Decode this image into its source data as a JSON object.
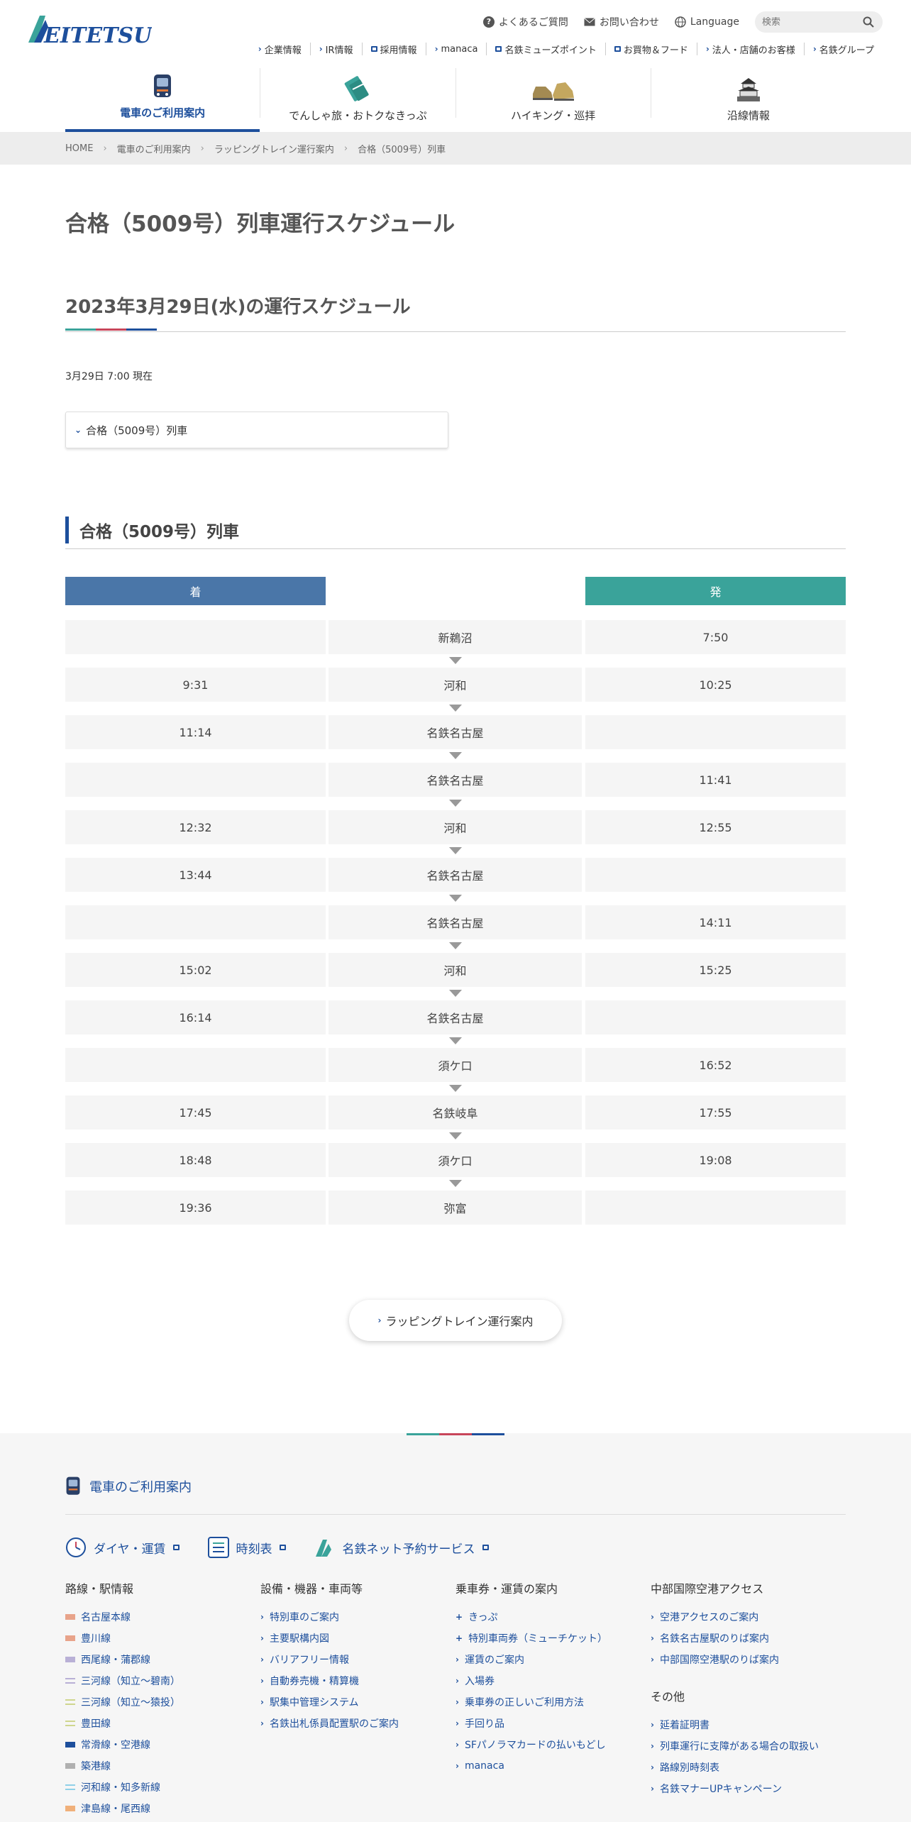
{
  "header": {
    "logo": "MEITETSU",
    "util": {
      "faq": "よくあるご質問",
      "contact": "お問い合わせ",
      "language": "Language",
      "search_placeholder": "検索"
    },
    "subnav": [
      "企業情報",
      "IR情報",
      "採用情報",
      "manaca",
      "名鉄ミューズポイント",
      "お買物＆フード",
      "法人・店舗のお客様",
      "名鉄グループ"
    ],
    "gnav": [
      "電車のご利用案内",
      "でんしゃ旅・おトクなきっぷ",
      "ハイキング・巡拝",
      "沿線情報"
    ]
  },
  "breadcrumb": [
    "HOME",
    "電車のご利用案内",
    "ラッピングトレイン運行案内",
    "合格（5009号）列車"
  ],
  "page": {
    "title": "合格（5009号）列車運行スケジュール",
    "date_heading": "2023年3月29日(水)の運行スケジュール",
    "as_of": "3月29日 7:00 現在",
    "toc_item": "合格（5009号）列車",
    "section_heading": "合格（5009号）列車",
    "col_arrive": "着",
    "col_depart": "発",
    "back_button": "ラッピングトレイン運行案内"
  },
  "schedule": [
    {
      "arr": "",
      "station": "新鵜沼",
      "dep": "7:50"
    },
    {
      "arr": "9:31",
      "station": "河和",
      "dep": "10:25"
    },
    {
      "arr": "11:14",
      "station": "名鉄名古屋",
      "dep": ""
    },
    {
      "arr": "",
      "station": "名鉄名古屋",
      "dep": "11:41"
    },
    {
      "arr": "12:32",
      "station": "河和",
      "dep": "12:55"
    },
    {
      "arr": "13:44",
      "station": "名鉄名古屋",
      "dep": ""
    },
    {
      "arr": "",
      "station": "名鉄名古屋",
      "dep": "14:11"
    },
    {
      "arr": "15:02",
      "station": "河和",
      "dep": "15:25"
    },
    {
      "arr": "16:14",
      "station": "名鉄名古屋",
      "dep": ""
    },
    {
      "arr": "",
      "station": "須ケ口",
      "dep": "16:52"
    },
    {
      "arr": "17:45",
      "station": "名鉄岐阜",
      "dep": "17:55"
    },
    {
      "arr": "18:48",
      "station": "須ケ口",
      "dep": "19:08"
    },
    {
      "arr": "19:36",
      "station": "弥富",
      "dep": ""
    }
  ],
  "footer": {
    "title": "電車のご利用案内",
    "links": [
      "ダイヤ・運賃",
      "時刻表",
      "名鉄ネット予約サービス"
    ],
    "col1": {
      "heading": "路線・駅情報",
      "items": [
        "名古屋本線",
        "豊川線",
        "西尾線・蒲郡線",
        "三河線（知立〜碧南）",
        "三河線（知立〜猿投）",
        "豊田線",
        "常滑線・空港線",
        "築港線",
        "河和線・知多新線",
        "津島線・尾西線"
      ]
    },
    "col2": {
      "heading": "設備・機器・車両等",
      "items": [
        "特別車のご案内",
        "主要駅構内図",
        "バリアフリー情報",
        "自動券売機・精算機",
        "駅集中管理システム",
        "名鉄出札係員配置駅のご案内"
      ]
    },
    "col3": {
      "heading": "乗車券・運賃の案内",
      "items": [
        "きっぷ",
        "特別車両券（ミューチケット）",
        "運賃のご案内",
        "入場券",
        "乗車券の正しいご利用方法",
        "手回り品",
        "SFパノラマカードの払いもどし",
        "manaca"
      ]
    },
    "col4": {
      "heading": "中部国際空港アクセス",
      "items": [
        "空港アクセスのご案内",
        "名鉄名古屋駅のりば案内",
        "中部国際空港駅のりば案内"
      ],
      "heading2": "その他",
      "items2": [
        "延着証明書",
        "列車運行に支障がある場合の取扱い",
        "路線別時刻表",
        "名鉄マナーUPキャンペーン"
      ]
    }
  },
  "colors": {
    "brand": "#1d4f9c",
    "arrive_header": "#4a76a8",
    "depart_header": "#3aa39a",
    "accent_red": "#c8455a"
  },
  "line_colors": [
    "#e8a38a",
    "#e8a38a",
    "#b9b0d6",
    "#b9b0d6",
    "#cfd68f",
    "#cfd68f",
    "#1d4f9c",
    "#b0b0b0",
    "#8fd0e8",
    "#f0b07a"
  ]
}
